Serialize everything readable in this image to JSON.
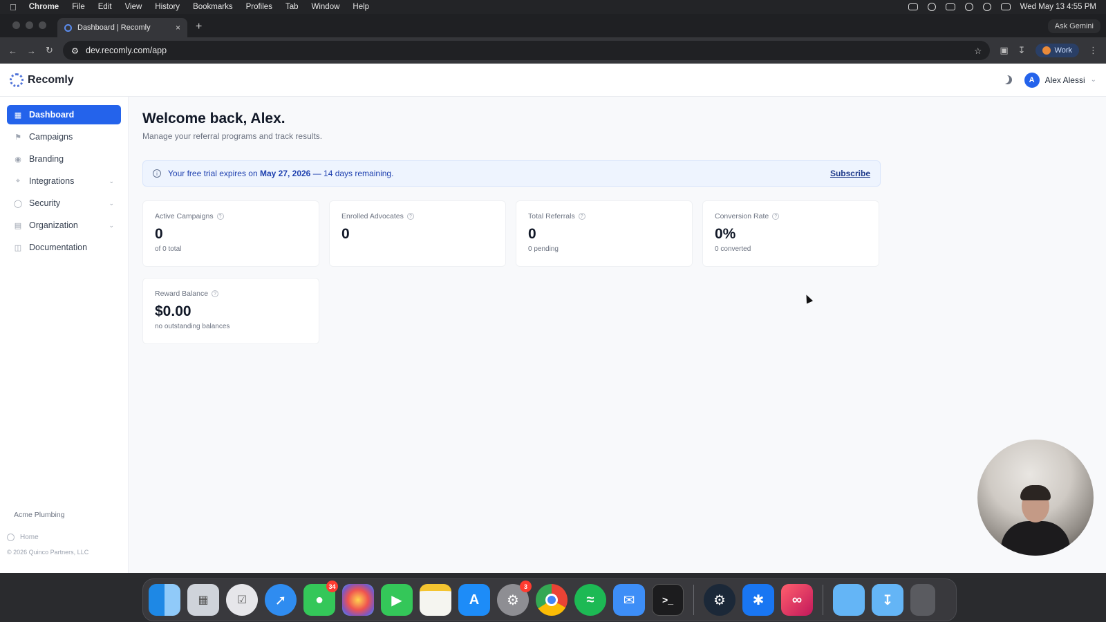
{
  "menubar": {
    "app": "Chrome",
    "items": [
      "File",
      "Edit",
      "View",
      "History",
      "Bookmarks",
      "Profiles",
      "Tab",
      "Window",
      "Help"
    ],
    "clock": "Wed May 13  4:55 PM"
  },
  "browser": {
    "tab_title": "Dashboard | Recomly",
    "new_tab": "+",
    "close": "×",
    "gemini": "Ask Gemini",
    "url": "dev.recomly.com/app",
    "profile": "Work"
  },
  "app": {
    "brand": "Recomly",
    "user": {
      "initial": "A",
      "name": "Alex Alessi"
    },
    "accent": "#2463eb"
  },
  "sidebar": {
    "items": [
      {
        "label": "Dashboard",
        "icon": "grid-icon",
        "active": true
      },
      {
        "label": "Campaigns",
        "icon": "megaphone-icon"
      },
      {
        "label": "Branding",
        "icon": "palette-icon"
      },
      {
        "label": "Integrations",
        "icon": "plug-icon",
        "chevron": true
      },
      {
        "label": "Security",
        "icon": "shield-icon",
        "chevron": true
      },
      {
        "label": "Organization",
        "icon": "building-icon",
        "chevron": true
      },
      {
        "label": "Documentation",
        "icon": "book-icon"
      }
    ],
    "org_name": "Acme Plumbing",
    "home": "Home",
    "copyright": "© 2026 Quinco Partners, LLC"
  },
  "main": {
    "welcome": "Welcome back, Alex.",
    "subtitle": "Manage your referral programs and track results.",
    "banner": {
      "prefix": "Your free trial expires on ",
      "date": "May 27, 2026",
      "suffix": " — 14 days remaining.",
      "action": "Subscribe"
    },
    "cards": [
      {
        "label": "Active Campaigns",
        "value": "0",
        "note": "of 0 total"
      },
      {
        "label": "Enrolled Advocates",
        "value": "0",
        "note": ""
      },
      {
        "label": "Total Referrals",
        "value": "0",
        "note": "0 pending"
      },
      {
        "label": "Conversion Rate",
        "value": "0%",
        "note": "0 converted"
      },
      {
        "label": "Reward Balance",
        "value": "$0.00",
        "note": "no outstanding balances"
      }
    ]
  },
  "dock": {
    "badges": {
      "messages": "34",
      "settings": "3"
    }
  }
}
